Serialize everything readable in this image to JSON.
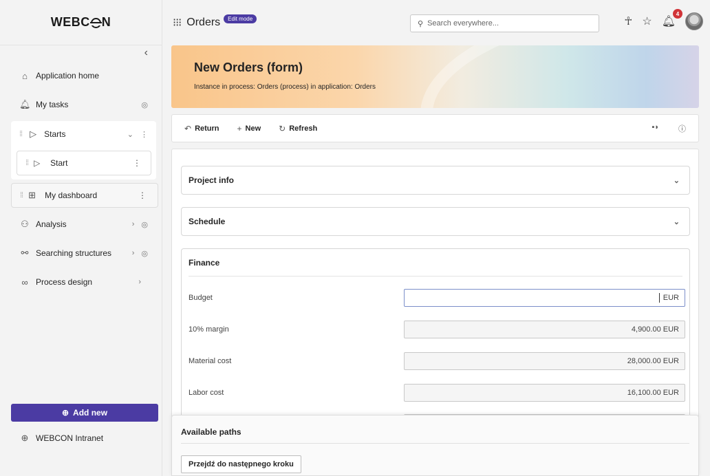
{
  "brand": {
    "logo_pre": "WEBC",
    "logo_post": "N"
  },
  "sidebar": {
    "collapse_glyph": "‹",
    "items": [
      {
        "label": "Application home",
        "icon": "home-icon"
      },
      {
        "label": "My tasks",
        "icon": "bell-icon"
      },
      {
        "label": "Starts",
        "icon": "play-icon"
      },
      {
        "label": "Start",
        "icon": "play-icon"
      },
      {
        "label": "My dashboard",
        "icon": "dashboard-icon"
      },
      {
        "label": "Analysis",
        "icon": "analysis-icon"
      },
      {
        "label": "Searching structures",
        "icon": "structure-icon"
      },
      {
        "label": "Process design",
        "icon": "process-icon"
      }
    ],
    "add_new": "Add new",
    "intranet": "WEBCON Intranet"
  },
  "header": {
    "app_title": "Orders",
    "edit_badge": "Edit mode",
    "search_placeholder": "Search everywhere...",
    "notifications_count": "4"
  },
  "banner": {
    "title": "New Orders (form)",
    "subtitle": "Instance in process: Orders (process) in application: Orders"
  },
  "toolbar": {
    "return_label": "Return",
    "new_label": "New",
    "refresh_label": "Refresh"
  },
  "form": {
    "sections": [
      {
        "title": "Project info"
      },
      {
        "title": "Schedule"
      },
      {
        "title": "Finance"
      }
    ],
    "fields": [
      {
        "label": "Budget",
        "value": "EUR",
        "editable": true
      },
      {
        "label": "10% margin",
        "value": "4,900.00 EUR"
      },
      {
        "label": "Material cost",
        "value": "28,000.00 EUR"
      },
      {
        "label": "Labor cost",
        "value": "16,100.00 EUR"
      }
    ]
  },
  "paths": {
    "title": "Available paths",
    "button": "Przejdź do następnego kroku"
  },
  "colors": {
    "accent": "#4b3ba3",
    "badge": "#d13438"
  }
}
